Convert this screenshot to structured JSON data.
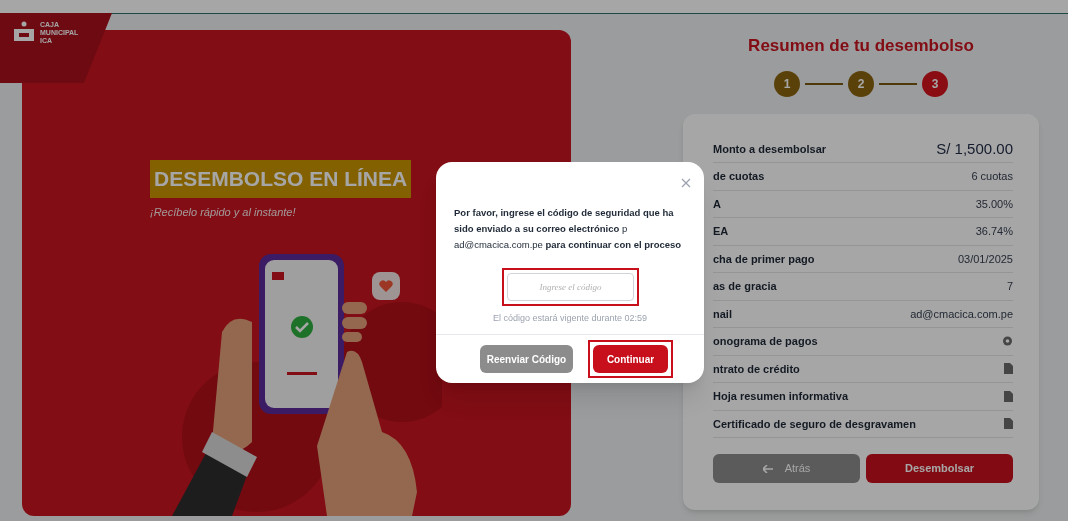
{
  "logo": {
    "lines": [
      "CAJA",
      "MUNICIPAL",
      "ICA"
    ]
  },
  "hero": {
    "title": "DESEMBOLSO EN LÍNEA",
    "subtitle": "¡Recíbelo rápido y al instante!"
  },
  "summary": {
    "title": "Resumen de tu desembolso",
    "steps": [
      {
        "label": "1",
        "selected": false
      },
      {
        "label": "2",
        "selected": false
      },
      {
        "label": "3",
        "selected": true
      }
    ],
    "rows": [
      {
        "kind": "amount",
        "label": "Monto a desembolsar",
        "value": "S/ 1,500.00"
      },
      {
        "kind": "text",
        "label": "de cuotas",
        "value": "6 cuotas"
      },
      {
        "kind": "text",
        "label": "A",
        "value": "35.00%"
      },
      {
        "kind": "text",
        "label": "EA",
        "value": "36.74%"
      },
      {
        "kind": "text",
        "label": "cha de primer pago",
        "value": "03/01/2025"
      },
      {
        "kind": "text",
        "label": "as de gracia",
        "value": "7"
      },
      {
        "kind": "text",
        "label": "nail",
        "value": "ad@cmacica.com.pe"
      },
      {
        "kind": "view",
        "label": "onograma de pagos"
      },
      {
        "kind": "document",
        "label": "ntrato de crédito"
      },
      {
        "kind": "document",
        "label": "Hoja resumen informativa"
      },
      {
        "kind": "document",
        "label": "Certificado de seguro de desgravamen"
      }
    ],
    "back_button": "Atrás",
    "submit_button": "Desembolsar"
  },
  "modal": {
    "message": "**Por favor, ingrese el código de seguridad que ha sido enviado a su correo electrónico** p                          ad@cmacica.com.pe **para continuar con el proceso**",
    "code_field": {
      "placeholder": "Ingrese el código",
      "highlighted": true
    },
    "timer": "El código estará vigente durante 02:59",
    "resend_button": "Reenviar Código",
    "continue_button": {
      "label": "Continuar",
      "highlighted": true
    }
  }
}
